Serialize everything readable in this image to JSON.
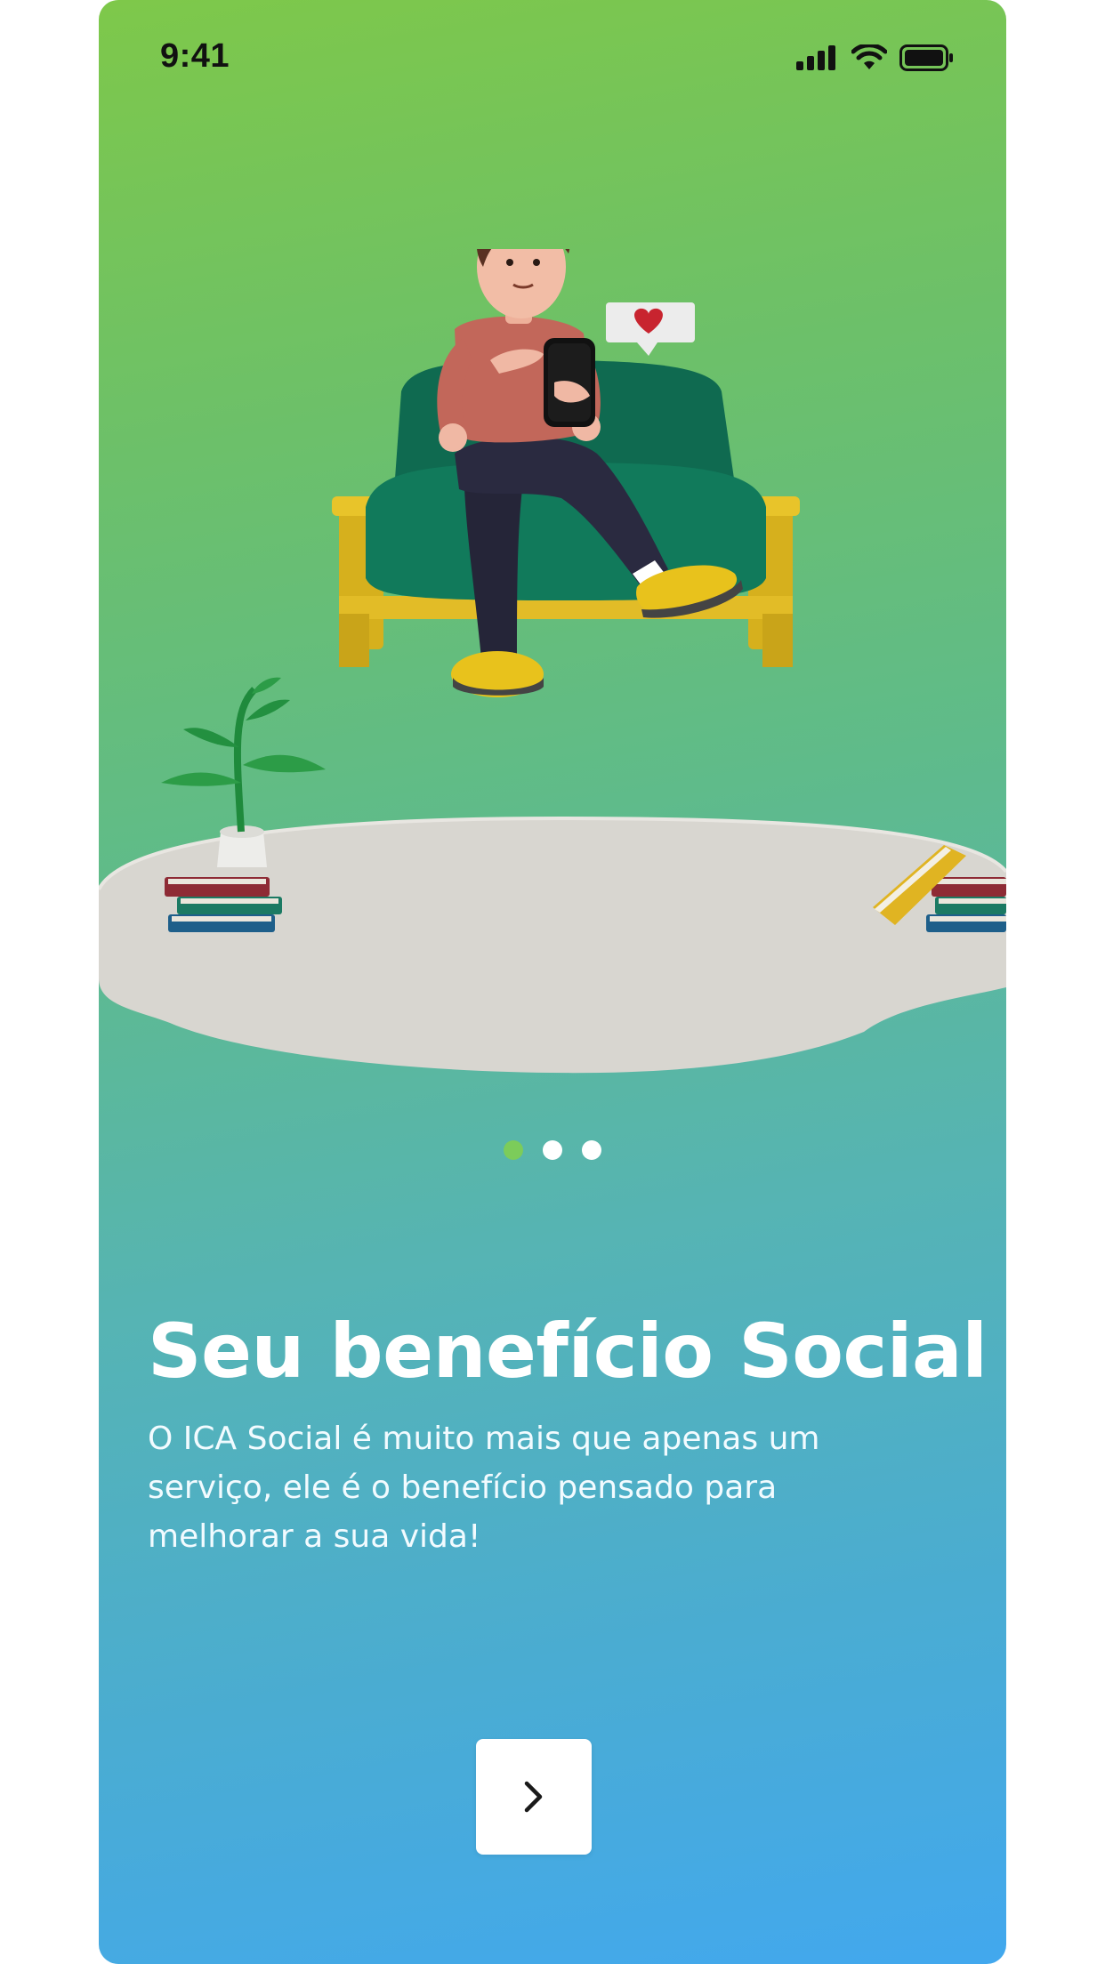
{
  "status_bar": {
    "time": "9:41",
    "icons": [
      "cellular-signal-icon",
      "wifi-icon",
      "battery-icon"
    ]
  },
  "onboarding": {
    "pagination": {
      "total": 3,
      "active_index": 0
    },
    "title": "Seu benefício Social",
    "description": "O ICA Social é muito mais que apenas um serviço, ele é o benefício pensado para melhorar a sua vida!",
    "next_button_icon": "chevron-right-icon"
  },
  "colors": {
    "gradient_top": "#7ec84a",
    "gradient_bottom": "#42a8ee",
    "active_dot": "#7ccc5a",
    "inactive_dot": "#ffffff",
    "button_bg": "#ffffff"
  }
}
